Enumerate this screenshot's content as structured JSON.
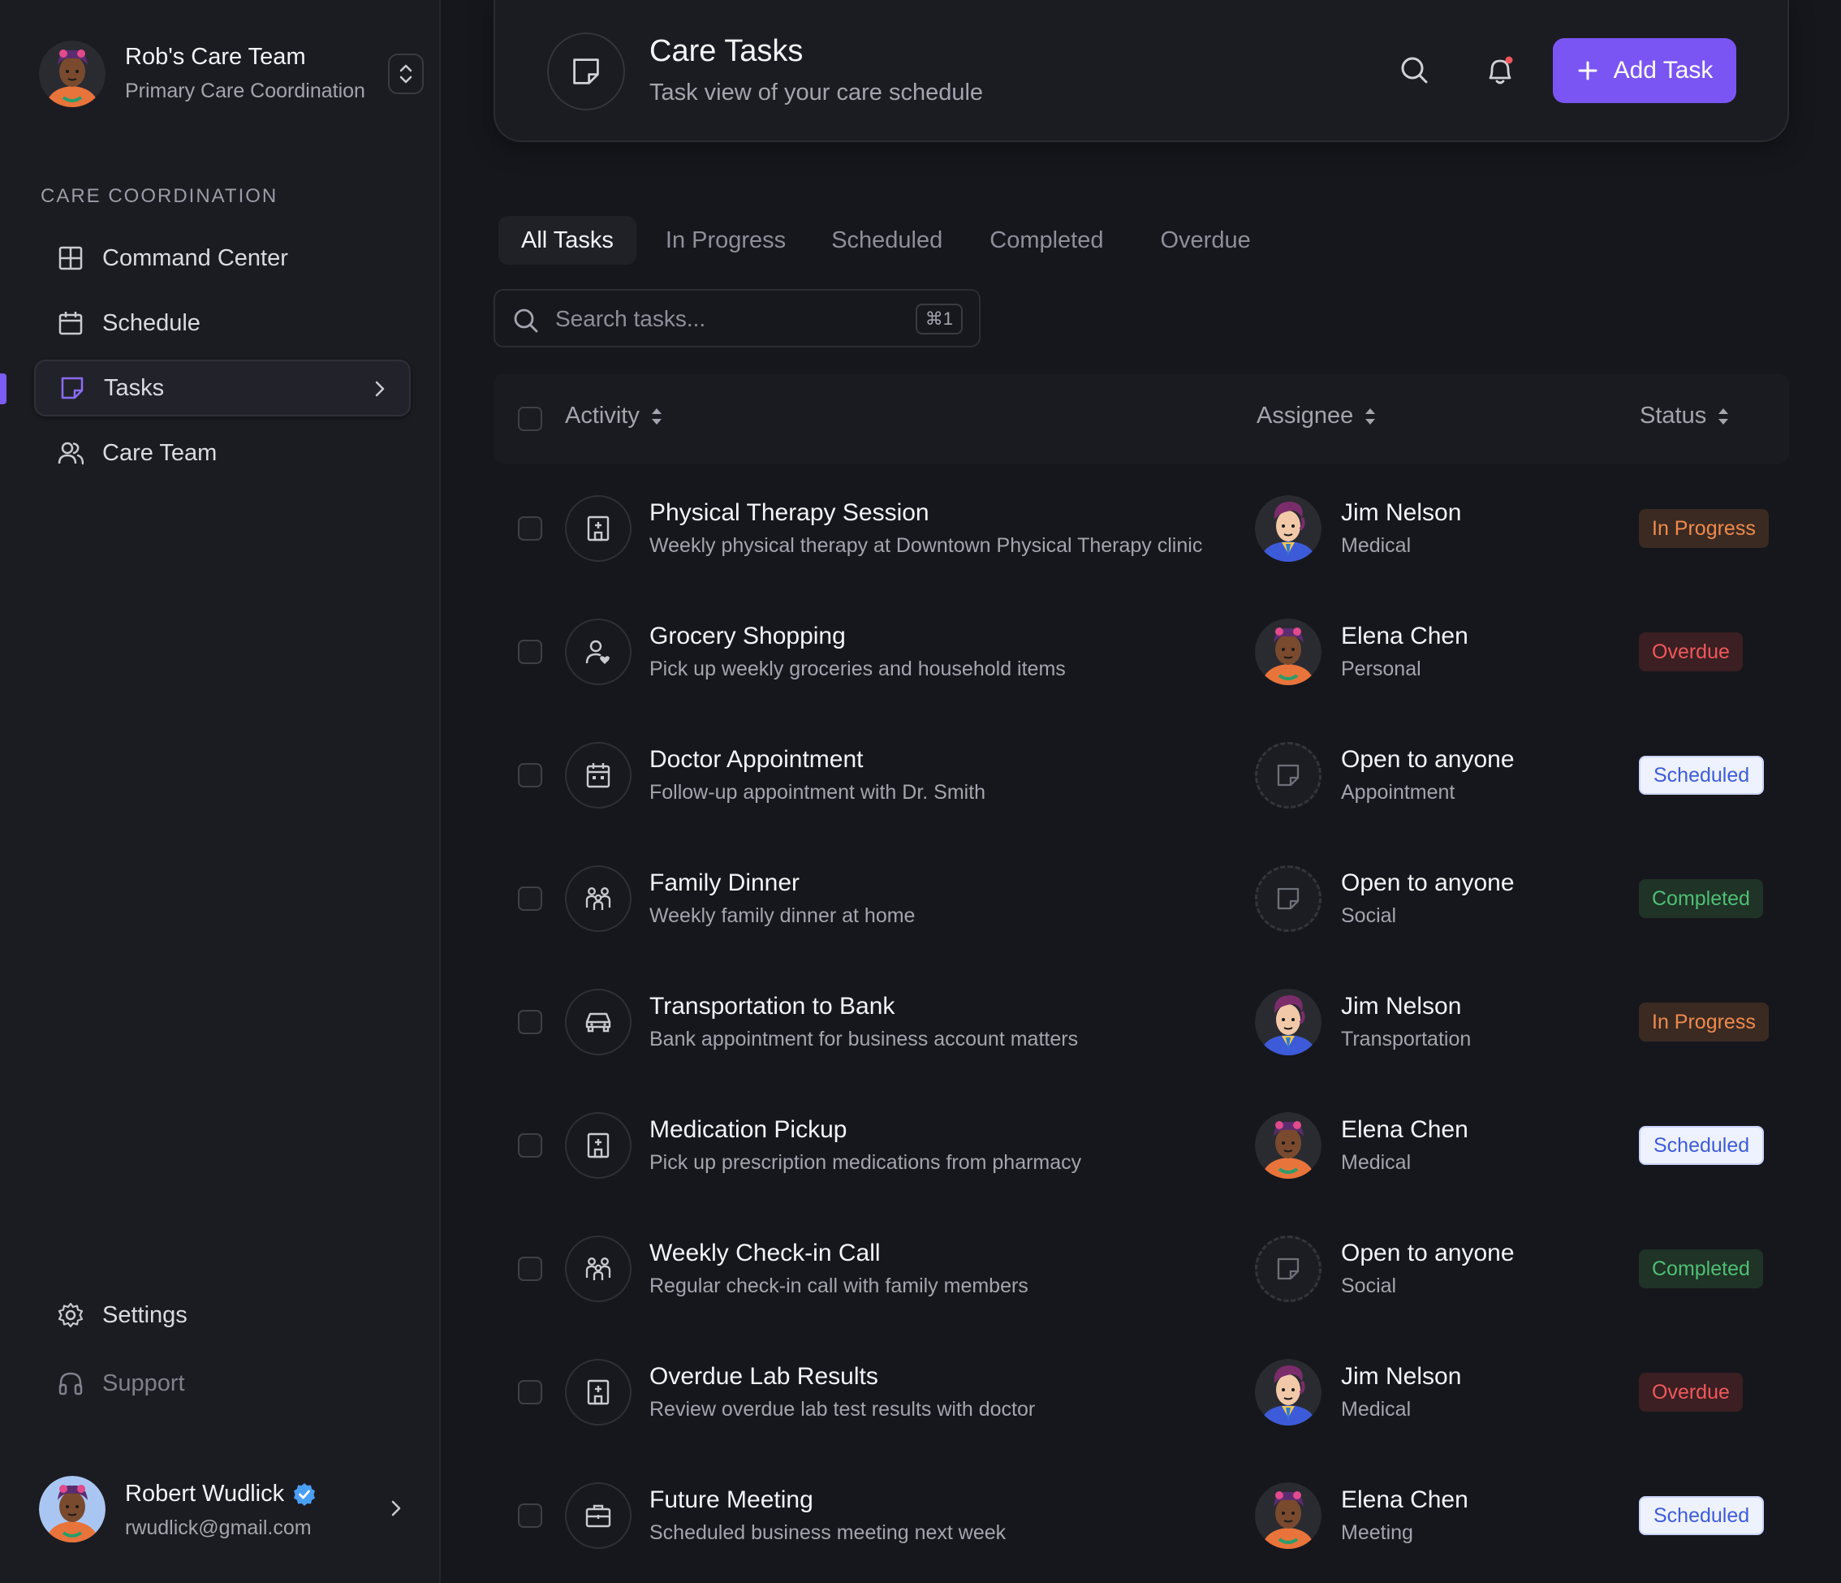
{
  "sidebar": {
    "team_name": "Rob's Care Team",
    "team_subtitle": "Primary Care Coordination",
    "section_label": "CARE COORDINATION",
    "nav": [
      {
        "label": "Command Center",
        "icon": "grid-icon"
      },
      {
        "label": "Schedule",
        "icon": "calendar-icon"
      },
      {
        "label": "Tasks",
        "icon": "sticky-note-icon",
        "active": true
      },
      {
        "label": "Care Team",
        "icon": "users-icon"
      }
    ],
    "footer_nav": [
      {
        "label": "Settings",
        "icon": "gear-icon"
      },
      {
        "label": "Support",
        "icon": "headset-icon"
      }
    ],
    "user": {
      "name": "Robert Wudlick",
      "email": "rwudlick@gmail.com",
      "verified": true
    }
  },
  "header": {
    "title": "Care Tasks",
    "subtitle": "Task view of your care schedule",
    "add_button": "Add Task"
  },
  "tabs": [
    "All Tasks",
    "In Progress",
    "Scheduled",
    "Completed",
    "Overdue"
  ],
  "search": {
    "placeholder": "Search tasks...",
    "shortcut": "⌘1"
  },
  "table": {
    "columns": [
      "Activity",
      "Assignee",
      "Status"
    ],
    "rows": [
      {
        "title": "Physical Therapy Session",
        "description": "Weekly physical therapy at Downtown Physical Therapy clinic",
        "icon": "hospital-icon",
        "assignee": "Jim Nelson",
        "category": "Medical",
        "status": "In Progress"
      },
      {
        "title": "Grocery Shopping",
        "description": "Pick up weekly groceries and household items",
        "icon": "user-heart-icon",
        "assignee": "Elena Chen",
        "category": "Personal",
        "status": "Overdue"
      },
      {
        "title": "Doctor Appointment",
        "description": "Follow-up appointment with Dr. Smith",
        "icon": "calendar-icon",
        "assignee": "Open to anyone",
        "category": "Appointment",
        "status": "Scheduled"
      },
      {
        "title": "Family Dinner",
        "description": "Weekly family dinner at home",
        "icon": "family-icon",
        "assignee": "Open to anyone",
        "category": "Social",
        "status": "Completed"
      },
      {
        "title": "Transportation to Bank",
        "description": "Bank appointment for business account matters",
        "icon": "car-icon",
        "assignee": "Jim Nelson",
        "category": "Transportation",
        "status": "In Progress"
      },
      {
        "title": "Medication Pickup",
        "description": "Pick up prescription medications from pharmacy",
        "icon": "hospital-icon",
        "assignee": "Elena Chen",
        "category": "Medical",
        "status": "Scheduled"
      },
      {
        "title": "Weekly Check-in Call",
        "description": "Regular check-in call with family members",
        "icon": "family-icon",
        "assignee": "Open to anyone",
        "category": "Social",
        "status": "Completed"
      },
      {
        "title": "Overdue Lab Results",
        "description": "Review overdue lab test results with doctor",
        "icon": "hospital-icon",
        "assignee": "Jim Nelson",
        "category": "Medical",
        "status": "Overdue"
      },
      {
        "title": "Future Meeting",
        "description": "Scheduled business meeting next week",
        "icon": "briefcase-icon",
        "assignee": "Elena Chen",
        "category": "Meeting",
        "status": "Scheduled"
      }
    ]
  },
  "colors": {
    "accent": "#7a55f3",
    "in_progress": "#ef8a4d",
    "overdue": "#f0585b",
    "scheduled": "#3e5cd8",
    "completed": "#4fbf74",
    "verified": "#4a9ff5"
  }
}
